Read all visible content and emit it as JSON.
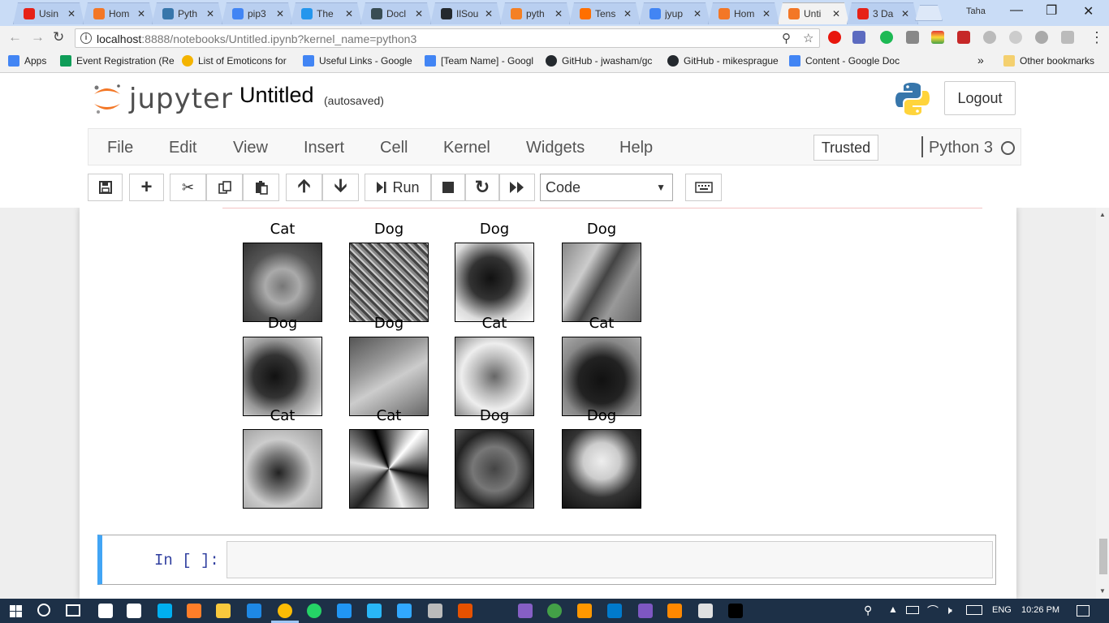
{
  "browser": {
    "tabs": [
      {
        "label": "Usin",
        "color": "#e62117"
      },
      {
        "label": "Hom",
        "color": "#f37726"
      },
      {
        "label": "Pyth",
        "color": "#3776ab"
      },
      {
        "label": "pip3",
        "color": "#4285f4"
      },
      {
        "label": "The",
        "color": "#2496ed"
      },
      {
        "label": "Docl",
        "color": "#394d54"
      },
      {
        "label": "IlSou",
        "color": "#24292e"
      },
      {
        "label": "pyth",
        "color": "#f48024"
      },
      {
        "label": "Tens",
        "color": "#ff6f00"
      },
      {
        "label": "jyup",
        "color": "#4285f4"
      },
      {
        "label": "Hom",
        "color": "#f37726"
      },
      {
        "label": "Unti",
        "color": "#f37726"
      },
      {
        "label": "3 Da",
        "color": "#e62117"
      }
    ],
    "user": "Taha",
    "url_host": "localhost",
    "url_rest": ":8888/notebooks/Untitled.ipynb?kernel_name=python3",
    "bookmarks": [
      {
        "label": "Apps",
        "color": "#4285f4"
      },
      {
        "label": "Event Registration (Re",
        "color": "#0f9d58"
      },
      {
        "label": "List of Emoticons for",
        "color": "#f4b400"
      },
      {
        "label": "Useful Links - Google",
        "color": "#4285f4"
      },
      {
        "label": "[Team Name] - Googl",
        "color": "#4285f4"
      },
      {
        "label": "GitHub - jwasham/gc",
        "color": "#24292e"
      },
      {
        "label": "GitHub - mikesprague",
        "color": "#24292e"
      },
      {
        "label": "Content - Google Doc",
        "color": "#4285f4"
      }
    ],
    "bookmarks_more": "»",
    "other_bookmarks": "Other bookmarks"
  },
  "jupyter": {
    "logo_text": "jupyter",
    "notebook_title": "Untitled",
    "autosave_status": "(autosaved)",
    "logout_label": "Logout",
    "menus": [
      "File",
      "Edit",
      "View",
      "Insert",
      "Cell",
      "Kernel",
      "Widgets",
      "Help"
    ],
    "trusted_label": "Trusted",
    "kernel_name": "Python 3",
    "run_label": "Run",
    "cell_type": "Code",
    "input_prompt": "In [ ]:"
  },
  "figure": {
    "titles": [
      "Cat",
      "Dog",
      "Dog",
      "Dog",
      "Dog",
      "Dog",
      "Cat",
      "Cat",
      "Cat",
      "Cat",
      "Dog",
      "Dog"
    ]
  },
  "taskbar": {
    "language": "ENG",
    "time": "10:26 PM"
  }
}
